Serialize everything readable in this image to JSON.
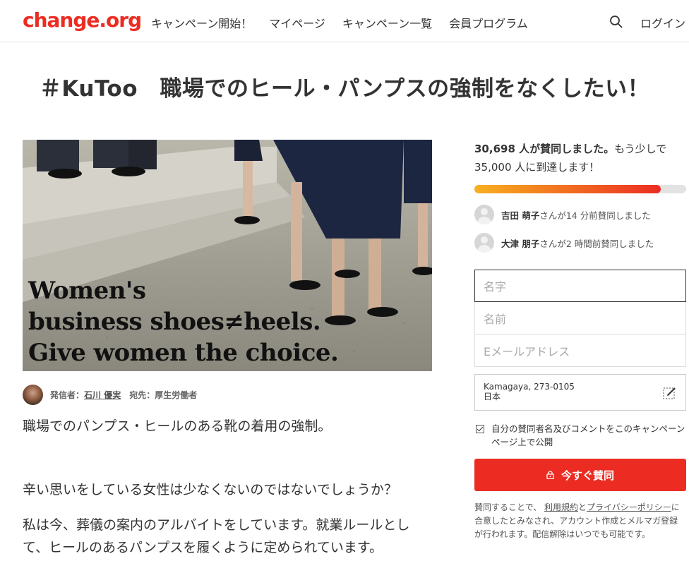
{
  "header": {
    "logo": "change.org",
    "nav": [
      "キャンペーン開始！",
      "マイページ",
      "キャンペーン一覧",
      "会員プログラム"
    ],
    "login": "ログイン"
  },
  "title": "＃KuToo　職場でのヒール・パンプスの強制をなくしたい！",
  "hero": {
    "caption_line1": "Women's",
    "caption_line2": "business shoes≠heels.",
    "caption_line3": "Give women the choice."
  },
  "author": {
    "label": "発信者：",
    "name": "石川 優実",
    "target": "宛先：厚生労働者"
  },
  "body": {
    "p1": "職場でのパンプス・ヒールのある靴の着用の強制。",
    "p2": "辛い思いをしている女性は少なくないのではないでしょうか？",
    "p3": "私は今、葬儀の案内のアルバイトをしています。就業ルールとして、ヒールのあるパンプスを履くように定められています。"
  },
  "sidebar": {
    "count_bold": "30,698 人が賛同しました。",
    "count_rest": "もう少しで 35,000 人に到達します！",
    "progress": 0.88,
    "signers": [
      {
        "name": "吉田 萌子",
        "text": "さんが14 分前賛同しました"
      },
      {
        "name": "大津 朋子",
        "text": "さんが2 時間前賛同しました"
      }
    ],
    "form": {
      "last_name": "名字",
      "first_name": "名前",
      "email": "Eメールアドレス",
      "location_line1": "Kamagaya, 273-0105",
      "location_line2": "日本"
    },
    "consent": "自分の賛同者名及びコメントをこのキャンペーンページ上で公開",
    "sign_button": "今すぐ賛同",
    "legal_prefix": "賛同することで、",
    "legal_terms": "利用規約",
    "legal_and": "と",
    "legal_privacy": "プライバシーポリシー",
    "legal_suffix": "に合意したとみなされ、アカウント作成とメルマガ登録が行われます。配信解除はいつでも可能です。"
  },
  "colors": {
    "brand": "#ec2c22",
    "progress_start": "#f7b020",
    "progress_end": "#ec2c22"
  }
}
